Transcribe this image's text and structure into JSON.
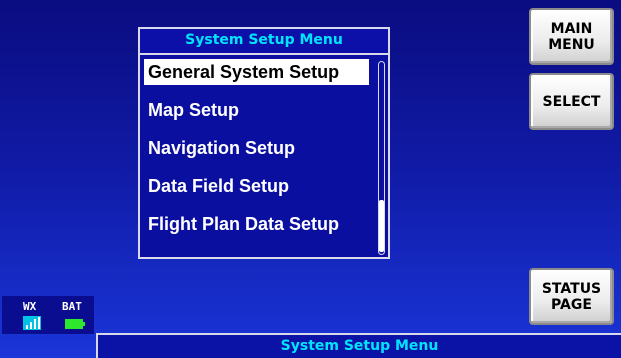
{
  "menu": {
    "title": "System Setup Menu",
    "items": [
      {
        "label": "General System Setup",
        "selected": true
      },
      {
        "label": "Map Setup",
        "selected": false
      },
      {
        "label": "Navigation Setup",
        "selected": false
      },
      {
        "label": "Data Field Setup",
        "selected": false
      },
      {
        "label": "Flight Plan Data Setup",
        "selected": false
      }
    ],
    "scroll_position": 1.0
  },
  "buttons": {
    "main_menu": "MAIN\nMENU",
    "select": "SELECT",
    "status_page": "STATUS\nPAGE"
  },
  "indicators": {
    "wx_label": "WX",
    "bat_label": "BAT",
    "wx_icon": "signal-bars-icon",
    "bat_icon": "battery-icon"
  },
  "status_bar": {
    "title": "System Setup Menu"
  },
  "colors": {
    "background_top": "#0a0c80",
    "background_bottom": "#1a35d8",
    "title_cyan": "#00e5ff",
    "battery_green": "#2ee82e",
    "wx_cyan": "#00c3e6"
  }
}
